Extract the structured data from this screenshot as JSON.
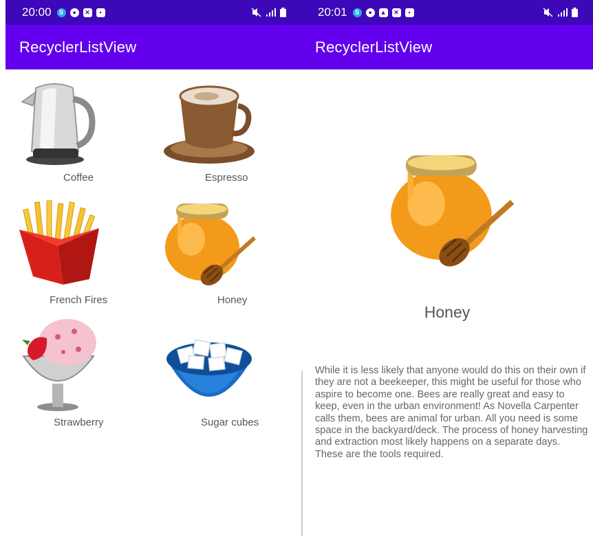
{
  "left_screen": {
    "status_time": "20:00",
    "app_title": "RecyclerListView",
    "items": [
      {
        "label": "Coffee",
        "icon": "kettle-icon"
      },
      {
        "label": "Espresso",
        "icon": "coffee-cup-icon"
      },
      {
        "label": "French Fires",
        "icon": "french-fries-icon"
      },
      {
        "label": "Honey",
        "icon": "honey-pot-icon"
      },
      {
        "label": "Strawberry",
        "icon": "ice-cream-icon"
      },
      {
        "label": "Sugar cubes",
        "icon": "sugar-bowl-icon"
      }
    ]
  },
  "right_screen": {
    "status_time": "20:01",
    "app_title": "RecyclerListView",
    "detail_title": "Honey",
    "detail_description": "While it is less likely that anyone would do this on their own if they are not a beekeeper, this might be useful for those who aspire to become one. Bees are really great and easy to keep, even in the urban environment! As Novella Carpenter calls them, bees are animal for urban. All you need is some space in the backyard/deck. The process of honey harvesting and extraction most likely happens on a separate days. These are the tools required."
  },
  "colors": {
    "status_bar": "#3d08b8",
    "app_bar": "#6200ee",
    "text": "#555555"
  }
}
